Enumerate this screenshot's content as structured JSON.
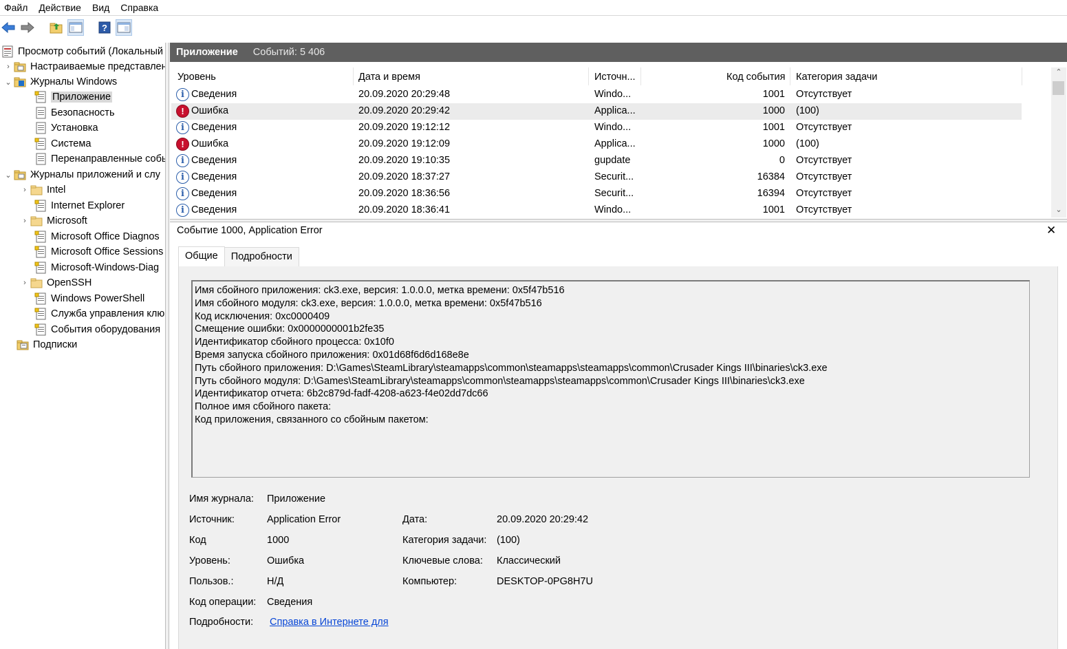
{
  "menu": [
    "Файл",
    "Действие",
    "Вид",
    "Справка"
  ],
  "toolbar": {
    "icons": [
      "back-arrow-icon",
      "forward-arrow-icon",
      "folder-up-icon",
      "console-tree-icon",
      "help-icon",
      "action-pane-icon"
    ]
  },
  "tree": {
    "items": [
      {
        "label": "Просмотр событий (Локальный",
        "level": 0,
        "arrow": "",
        "icon": "event-viewer-icon"
      },
      {
        "label": "Настраиваемые представлен",
        "level": 1,
        "arrow": "›",
        "icon": "folder-icon"
      },
      {
        "label": "Журналы Windows",
        "level": 1,
        "arrow": "⌄",
        "icon": "windows-logs-icon"
      },
      {
        "label": "Приложение",
        "level": 2,
        "arrow": "",
        "icon": "log-icon",
        "selected": true
      },
      {
        "label": "Безопасность",
        "level": 2,
        "arrow": "",
        "icon": "log-icon"
      },
      {
        "label": "Установка",
        "level": 2,
        "arrow": "",
        "icon": "log-icon"
      },
      {
        "label": "Система",
        "level": 2,
        "arrow": "",
        "icon": "log-icon"
      },
      {
        "label": "Перенаправленные собы",
        "level": 2,
        "arrow": "",
        "icon": "log-icon"
      },
      {
        "label": "Журналы приложений и слу",
        "level": 1,
        "arrow": "⌄",
        "icon": "folder-icon"
      },
      {
        "label": "Intel",
        "level": 2,
        "arrow": "›",
        "icon": "folder-icon"
      },
      {
        "label": "Internet Explorer",
        "level": 2,
        "arrow": "",
        "icon": "log-icon"
      },
      {
        "label": "Microsoft",
        "level": 2,
        "arrow": "›",
        "icon": "folder-icon"
      },
      {
        "label": "Microsoft Office Diagnos",
        "level": 2,
        "arrow": "",
        "icon": "log-icon"
      },
      {
        "label": "Microsoft Office Sessions",
        "level": 2,
        "arrow": "",
        "icon": "log-icon"
      },
      {
        "label": "Microsoft-Windows-Diag",
        "level": 2,
        "arrow": "",
        "icon": "log-icon"
      },
      {
        "label": "OpenSSH",
        "level": 2,
        "arrow": "›",
        "icon": "folder-icon"
      },
      {
        "label": "Windows PowerShell",
        "level": 2,
        "arrow": "",
        "icon": "log-icon"
      },
      {
        "label": "Служба управления клю",
        "level": 2,
        "arrow": "",
        "icon": "log-icon"
      },
      {
        "label": "События оборудования",
        "level": 2,
        "arrow": "",
        "icon": "log-icon"
      },
      {
        "label": "Подписки",
        "level": 1,
        "arrow": "",
        "icon": "subscriptions-icon"
      }
    ]
  },
  "pane": {
    "title": "Приложение",
    "count": "Событий: 5 406"
  },
  "list": {
    "columns": [
      "Уровень",
      "Дата и время",
      "Источн...",
      "Код события",
      "Категория задачи"
    ],
    "rows": [
      {
        "level": "Сведения",
        "type": "info",
        "date": "20.09.2020 20:29:48",
        "source": "Windo...",
        "code": "1001",
        "category": "Отсутствует"
      },
      {
        "level": "Ошибка",
        "type": "err",
        "date": "20.09.2020 20:29:42",
        "source": "Applica...",
        "code": "1000",
        "category": "(100)",
        "selected": true
      },
      {
        "level": "Сведения",
        "type": "info",
        "date": "20.09.2020 19:12:12",
        "source": "Windo...",
        "code": "1001",
        "category": "Отсутствует"
      },
      {
        "level": "Ошибка",
        "type": "err",
        "date": "20.09.2020 19:12:09",
        "source": "Applica...",
        "code": "1000",
        "category": "(100)"
      },
      {
        "level": "Сведения",
        "type": "info",
        "date": "20.09.2020 19:10:35",
        "source": "gupdate",
        "code": "0",
        "category": "Отсутствует"
      },
      {
        "level": "Сведения",
        "type": "info",
        "date": "20.09.2020 18:37:27",
        "source": "Securit...",
        "code": "16384",
        "category": "Отсутствует"
      },
      {
        "level": "Сведения",
        "type": "info",
        "date": "20.09.2020 18:36:56",
        "source": "Securit...",
        "code": "16394",
        "category": "Отсутствует"
      },
      {
        "level": "Сведения",
        "type": "info",
        "date": "20.09.2020 18:36:41",
        "source": "Windo...",
        "code": "1001",
        "category": "Отсутствует"
      }
    ]
  },
  "detail": {
    "title": "Событие 1000, Application Error",
    "tabs": [
      "Общие",
      "Подробности"
    ],
    "description": [
      "Имя сбойного приложения: ck3.exe, версия: 1.0.0.0, метка времени: 0x5f47b516",
      "Имя сбойного модуля: ck3.exe, версия: 1.0.0.0, метка времени: 0x5f47b516",
      "Код исключения: 0xc0000409",
      "Смещение ошибки: 0x0000000001b2fe35",
      "Идентификатор сбойного процесса: 0x10f0",
      "Время запуска сбойного приложения: 0x01d68f6d6d168e8e",
      "Путь сбойного приложения: D:\\Games\\SteamLibrary\\steamapps\\common\\steamapps\\steamapps\\common\\Crusader Kings III\\binaries\\ck3.exe",
      "Путь сбойного модуля: D:\\Games\\SteamLibrary\\steamapps\\common\\steamapps\\steamapps\\common\\Crusader Kings III\\binaries\\ck3.exe",
      "Идентификатор отчета: 6b2c879d-fadf-4208-a623-f4e02dd7dc66",
      "Полное имя сбойного пакета:",
      "Код приложения, связанного со сбойным пакетом:"
    ],
    "fields": {
      "log_name_label": "Имя журнала:",
      "log_name": "Приложение",
      "source_label": "Источник:",
      "source": "Application Error",
      "date_label": "Дата:",
      "date": "20.09.2020 20:29:42",
      "code_label": "Код",
      "code": "1000",
      "task_label": "Категория задачи:",
      "task": "(100)",
      "level_label": "Уровень:",
      "level": "Ошибка",
      "keywords_label": "Ключевые слова:",
      "keywords": "Классический",
      "user_label": "Пользов.:",
      "user": "Н/Д",
      "computer_label": "Компьютер:",
      "computer": "DESKTOP-0PG8H7U",
      "opcode_label": "Код операции:",
      "opcode": "Сведения",
      "more_label": "Подробности:",
      "more_link": "Справка в Интернете для "
    }
  }
}
